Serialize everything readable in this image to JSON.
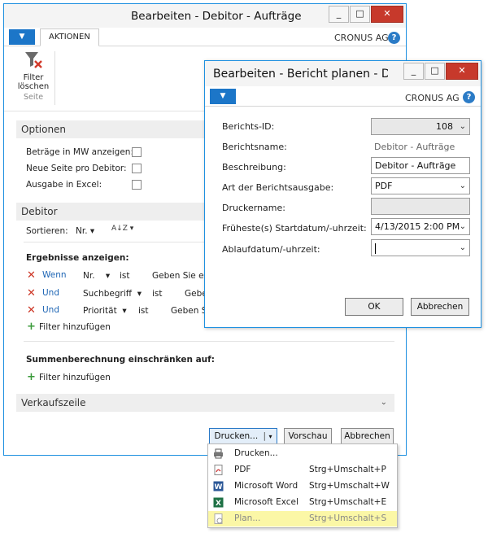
{
  "main": {
    "title": "Bearbeiten - Debitor - Aufträge",
    "win_buttons": [
      "_",
      "□",
      "✕"
    ],
    "tab_label": "AKTIONEN",
    "company": "CRONUS AG",
    "help": "?",
    "filter_button_label": "Filter\nlöschen",
    "filter_group": "Seite",
    "sections": {
      "optionen": "Optionen",
      "debitor": "Debitor",
      "verkaufszeile": "Verkaufszeile"
    },
    "options": [
      {
        "label": "Beträge in MW anzeigen:"
      },
      {
        "label": "Neue Seite pro Debitor:"
      },
      {
        "label": "Ausgabe in Excel:"
      }
    ],
    "sort": {
      "label": "Sortieren:",
      "value": "Nr.",
      "az_icon": "A↓Z"
    },
    "results_heading": "Ergebnisse anzeigen:",
    "filters": [
      {
        "conj": "Wenn",
        "field": "Nr.",
        "op": "ist",
        "value": "Geben Sie eine"
      },
      {
        "conj": "Und",
        "field": "Suchbegriff",
        "op": "ist",
        "value": "Gebe"
      },
      {
        "conj": "Und",
        "field": "Priorität",
        "op": "ist",
        "value": "Geben Si"
      }
    ],
    "add_filter": "Filter hinzufügen",
    "totals_heading": "Summenberechnung einschränken auf:",
    "add_filter2": "Filter hinzufügen",
    "buttons": {
      "print": "Drucken...",
      "preview": "Vorschau",
      "cancel": "Abbrechen"
    }
  },
  "dropdown": [
    {
      "label": "Drucken...",
      "shortcut": "",
      "icon": "printer-icon",
      "highlight": false
    },
    {
      "label": "PDF",
      "shortcut": "Strg+Umschalt+P",
      "icon": "pdf-icon",
      "highlight": false
    },
    {
      "label": "Microsoft Word",
      "shortcut": "Strg+Umschalt+W",
      "icon": "word-icon",
      "highlight": false
    },
    {
      "label": "Microsoft Excel",
      "shortcut": "Strg+Umschalt+E",
      "icon": "excel-icon",
      "highlight": false
    },
    {
      "label": "Plan...",
      "shortcut": "Strg+Umschalt+S",
      "icon": "schedule-icon",
      "highlight": true
    }
  ],
  "dialog": {
    "title": "Bearbeiten - Bericht planen - Deb",
    "company": "CRONUS AG",
    "help": "?",
    "fields": [
      {
        "label": "Berichts-ID:",
        "value": "108"
      },
      {
        "label": "Berichtsname:",
        "value": "Debitor - Aufträge"
      },
      {
        "label": "Beschreibung:",
        "value": "Debitor - Aufträge"
      },
      {
        "label": "Art der Berichtsausgabe:",
        "value": "PDF"
      },
      {
        "label": "Druckername:",
        "value": ""
      },
      {
        "label": "Früheste(s) Startdatum/-uhrzeit:",
        "value": "4/13/2015 2:00 PM"
      },
      {
        "label": "Ablaufdatum/-uhrzeit:",
        "value": ""
      }
    ],
    "ok": "OK",
    "cancel": "Abbrechen"
  },
  "colors": {
    "accent": "#1c76c8",
    "window_border": "#1e90e0",
    "close": "#c7392b",
    "highlight": "#fbf7a6"
  }
}
